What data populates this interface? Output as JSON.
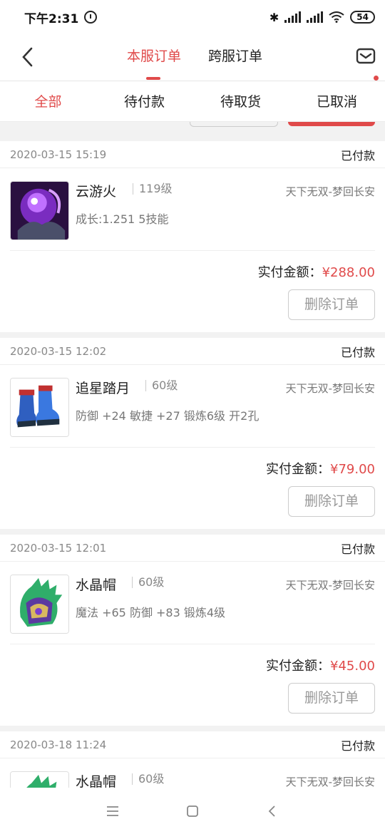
{
  "status": {
    "time": "下午2:31",
    "battery": "54"
  },
  "nav": {
    "tabs": [
      "本服订单",
      "跨服订单"
    ],
    "active_tab": 0
  },
  "filters": {
    "tabs": [
      "全部",
      "待付款",
      "待取货",
      "已取消"
    ],
    "active": 0
  },
  "orders": [
    {
      "date": "2020-03-15 15:19",
      "status": "已付款",
      "name": "云游火",
      "level": "119级",
      "server": "天下无双-梦回长安",
      "attrs": "成长:1.251 5技能",
      "pay_label": "实付金额：",
      "amount": "¥288.00",
      "delete_label": "删除订单",
      "icon": "purple-pet-icon"
    },
    {
      "date": "2020-03-15 12:02",
      "status": "已付款",
      "name": "追星踏月",
      "level": "60级",
      "server": "天下无双-梦回长安",
      "attrs": "防御 +24 敏捷 +27 锻炼6级 开2孔",
      "pay_label": "实付金额：",
      "amount": "¥79.00",
      "delete_label": "删除订单",
      "icon": "boots-icon"
    },
    {
      "date": "2020-03-15 12:01",
      "status": "已付款",
      "name": "水晶帽",
      "level": "60级",
      "server": "天下无双-梦回长安",
      "attrs": "魔法 +65 防御 +83 锻炼4级",
      "pay_label": "实付金额：",
      "amount": "¥45.00",
      "delete_label": "删除订单",
      "icon": "crystal-helmet-icon"
    },
    {
      "date": "2020-03-18 11:24",
      "status": "已付款",
      "name": "水晶帽",
      "level": "60级",
      "server": "天下无双-梦回长安",
      "icon": "crystal-helmet-icon"
    }
  ],
  "colors": {
    "accent": "#e04a4a"
  }
}
